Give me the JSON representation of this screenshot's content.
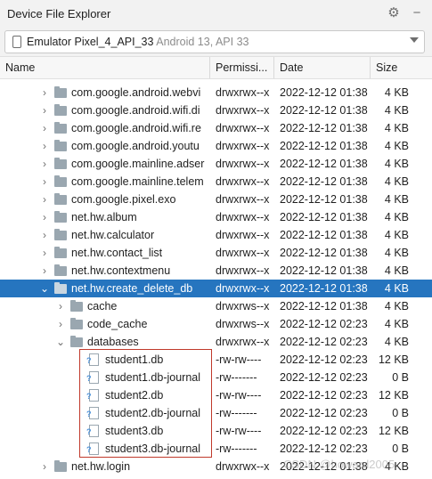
{
  "window": {
    "title": "Device File Explorer"
  },
  "toolbar": {
    "settings_icon": "gear-icon",
    "minimize_icon": "minimize-icon"
  },
  "device": {
    "name": "Emulator Pixel_4_API_33",
    "version": "Android 13, API 33"
  },
  "columns": {
    "name": "Name",
    "permissions": "Permissi...",
    "date": "Date",
    "size": "Size"
  },
  "rows": [
    {
      "name": "com.google.android.webvi",
      "perm": "drwxrwx--x",
      "date": "2022-12-12 01:38",
      "size": "4 KB",
      "kind": "folder",
      "depth": 0,
      "expand": "collapsed"
    },
    {
      "name": "com.google.android.wifi.di",
      "perm": "drwxrwx--x",
      "date": "2022-12-12 01:38",
      "size": "4 KB",
      "kind": "folder",
      "depth": 0,
      "expand": "collapsed"
    },
    {
      "name": "com.google.android.wifi.re",
      "perm": "drwxrwx--x",
      "date": "2022-12-12 01:38",
      "size": "4 KB",
      "kind": "folder",
      "depth": 0,
      "expand": "collapsed"
    },
    {
      "name": "com.google.android.youtu",
      "perm": "drwxrwx--x",
      "date": "2022-12-12 01:38",
      "size": "4 KB",
      "kind": "folder",
      "depth": 0,
      "expand": "collapsed"
    },
    {
      "name": "com.google.mainline.adser",
      "perm": "drwxrwx--x",
      "date": "2022-12-12 01:38",
      "size": "4 KB",
      "kind": "folder",
      "depth": 0,
      "expand": "collapsed"
    },
    {
      "name": "com.google.mainline.telem",
      "perm": "drwxrwx--x",
      "date": "2022-12-12 01:38",
      "size": "4 KB",
      "kind": "folder",
      "depth": 0,
      "expand": "collapsed"
    },
    {
      "name": "com.google.pixel.exo",
      "perm": "drwxrwx--x",
      "date": "2022-12-12 01:38",
      "size": "4 KB",
      "kind": "folder",
      "depth": 0,
      "expand": "collapsed"
    },
    {
      "name": "net.hw.album",
      "perm": "drwxrwx--x",
      "date": "2022-12-12 01:38",
      "size": "4 KB",
      "kind": "folder",
      "depth": 0,
      "expand": "collapsed"
    },
    {
      "name": "net.hw.calculator",
      "perm": "drwxrwx--x",
      "date": "2022-12-12 01:38",
      "size": "4 KB",
      "kind": "folder",
      "depth": 0,
      "expand": "collapsed"
    },
    {
      "name": "net.hw.contact_list",
      "perm": "drwxrwx--x",
      "date": "2022-12-12 01:38",
      "size": "4 KB",
      "kind": "folder",
      "depth": 0,
      "expand": "collapsed"
    },
    {
      "name": "net.hw.contextmenu",
      "perm": "drwxrwx--x",
      "date": "2022-12-12 01:38",
      "size": "4 KB",
      "kind": "folder",
      "depth": 0,
      "expand": "collapsed"
    },
    {
      "name": "net.hw.create_delete_db",
      "perm": "drwxrwx--x",
      "date": "2022-12-12 01:38",
      "size": "4 KB",
      "kind": "folder",
      "depth": 0,
      "expand": "expanded",
      "selected": true
    },
    {
      "name": "cache",
      "perm": "drwxrws--x",
      "date": "2022-12-12 01:38",
      "size": "4 KB",
      "kind": "folder",
      "depth": 1,
      "expand": "collapsed"
    },
    {
      "name": "code_cache",
      "perm": "drwxrws--x",
      "date": "2022-12-12 02:23",
      "size": "4 KB",
      "kind": "folder",
      "depth": 1,
      "expand": "collapsed"
    },
    {
      "name": "databases",
      "perm": "drwxrwx--x",
      "date": "2022-12-12 02:23",
      "size": "4 KB",
      "kind": "folder",
      "depth": 1,
      "expand": "expanded"
    },
    {
      "name": "student1.db",
      "perm": "-rw-rw----",
      "date": "2022-12-12 02:23",
      "size": "12 KB",
      "kind": "file",
      "depth": 2
    },
    {
      "name": "student1.db-journal",
      "perm": "-rw-------",
      "date": "2022-12-12 02:23",
      "size": "0 B",
      "kind": "file",
      "depth": 2
    },
    {
      "name": "student2.db",
      "perm": "-rw-rw----",
      "date": "2022-12-12 02:23",
      "size": "12 KB",
      "kind": "file",
      "depth": 2
    },
    {
      "name": "student2.db-journal",
      "perm": "-rw-------",
      "date": "2022-12-12 02:23",
      "size": "0 B",
      "kind": "file",
      "depth": 2
    },
    {
      "name": "student3.db",
      "perm": "-rw-rw----",
      "date": "2022-12-12 02:23",
      "size": "12 KB",
      "kind": "file",
      "depth": 2
    },
    {
      "name": "student3.db-journal",
      "perm": "-rw-------",
      "date": "2022-12-12 02:23",
      "size": "0 B",
      "kind": "file",
      "depth": 2
    },
    {
      "name": "net.hw.login",
      "perm": "drwxrwx--x",
      "date": "2022-12-12 01:38",
      "size": "4 KB",
      "kind": "folder",
      "depth": 0,
      "expand": "collapsed"
    }
  ],
  "watermark": "CSDN @howard2005",
  "colors": {
    "selection": "#2675bf",
    "highlight_box": "#c0392b",
    "folder": "#9aa7b0"
  }
}
